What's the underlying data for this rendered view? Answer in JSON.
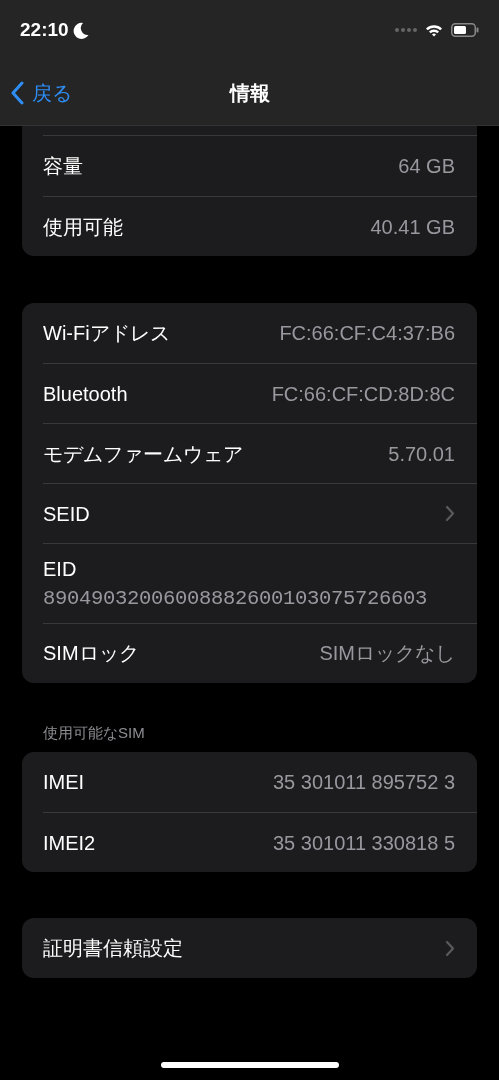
{
  "status_bar": {
    "time": "22:10",
    "focus_moon": true
  },
  "nav": {
    "back_label": "戻る",
    "title": "情報"
  },
  "sections": [
    {
      "cut_off_top": true,
      "rows": [
        {
          "kind": "value",
          "label": "容量",
          "value": "64 GB"
        },
        {
          "kind": "value",
          "label": "使用可能",
          "value": "40.41 GB"
        }
      ]
    },
    {
      "rows": [
        {
          "kind": "value",
          "label": "Wi-Fiアドレス",
          "value": "FC:66:CF:C4:37:B6"
        },
        {
          "kind": "value",
          "label": "Bluetooth",
          "value": "FC:66:CF:CD:8D:8C"
        },
        {
          "kind": "value",
          "label": "モデムファームウェア",
          "value": "5.70.01"
        },
        {
          "kind": "chevron",
          "label": "SEID"
        },
        {
          "kind": "stacked",
          "label": "EID",
          "value": "89049032006008882600103075726603"
        },
        {
          "kind": "value",
          "label": "SIMロック",
          "value": "SIMロックなし"
        }
      ]
    },
    {
      "header": "使用可能なSIM",
      "rows": [
        {
          "kind": "value",
          "label": "IMEI",
          "value": "35 301011 895752 3"
        },
        {
          "kind": "value",
          "label": "IMEI2",
          "value": "35 301011 330818 5"
        }
      ]
    },
    {
      "rows": [
        {
          "kind": "chevron",
          "label": "証明書信頼設定"
        }
      ]
    }
  ]
}
